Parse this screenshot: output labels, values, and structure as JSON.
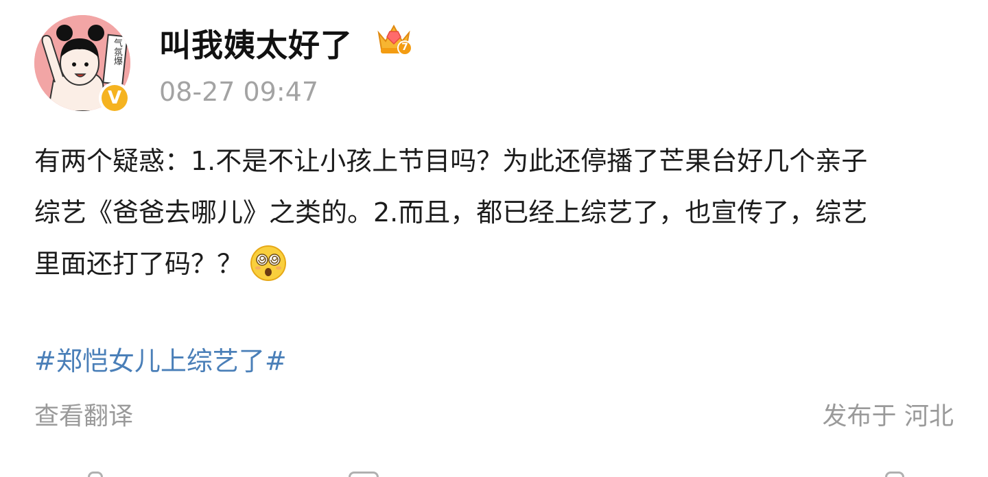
{
  "user": {
    "name": "叫我姨太好了",
    "avatar_text": "气氛爆",
    "verified_mark": "V",
    "vip_level": "7"
  },
  "post": {
    "time": "08-27 09:47",
    "lines": [
      "有两个疑惑：1.不是不让小孩上节目吗？为此还停播了芒果台好几个亲子",
      "综艺《爸爸去哪儿》之类的。2.而且，都已经上综艺了，也宣传了，综艺",
      "里面还打了码？？"
    ],
    "emoji": "dizzy-face-emoji",
    "hashtag": "#郑恺女儿上综艺了#",
    "translate_label": "查看翻译",
    "location_label": "发布于 河北"
  },
  "colors": {
    "hashtag": "#4a7fb8",
    "meta": "#9a9a9a",
    "badge": "#f5b320",
    "avatar_bg": "#f2a5a5"
  }
}
